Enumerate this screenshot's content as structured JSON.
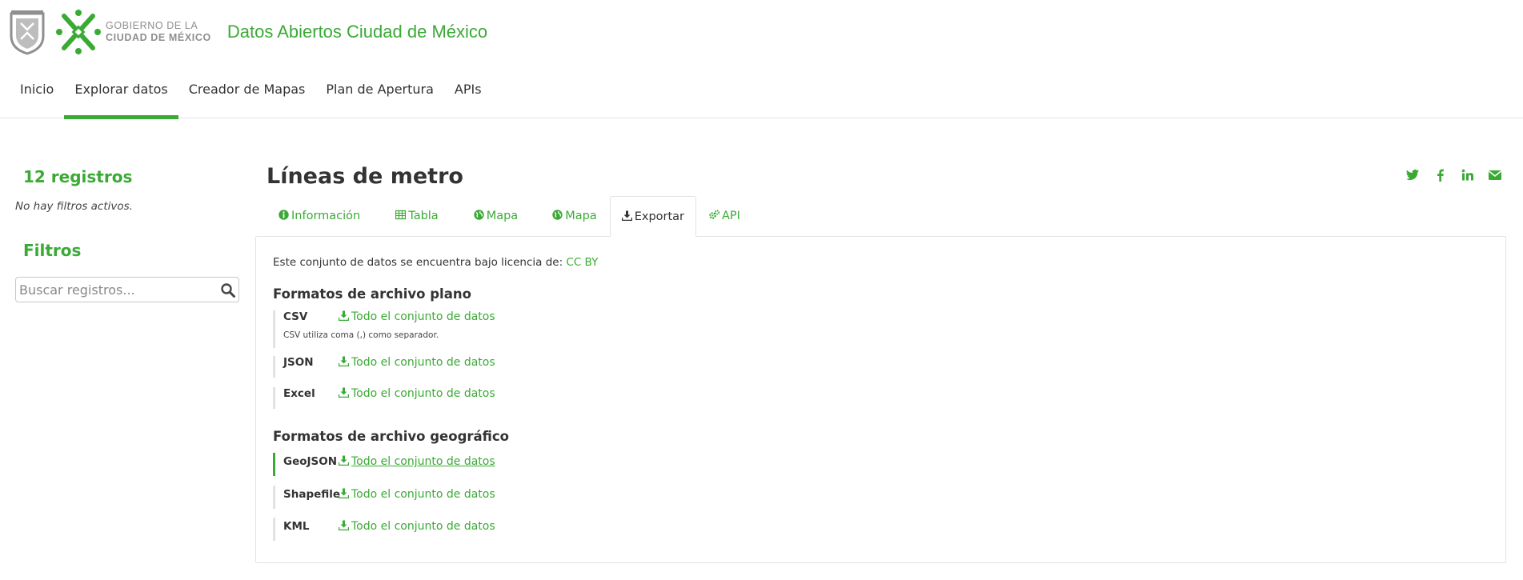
{
  "header": {
    "gov_line1": "GOBIERNO DE LA",
    "gov_line2": "CIUDAD DE MÉXICO",
    "site_title": "Datos Abiertos Ciudad de México",
    "brand_color": "#3aaa35"
  },
  "nav": {
    "items": [
      {
        "label": "Inicio"
      },
      {
        "label": "Explorar datos",
        "active": true
      },
      {
        "label": "Creador de Mapas"
      },
      {
        "label": "Plan de Apertura"
      },
      {
        "label": "APIs"
      }
    ]
  },
  "sidebar": {
    "records": "12 registros",
    "no_filters": "No hay filtros activos.",
    "filters_title": "Filtros",
    "search_placeholder": "Buscar registros..."
  },
  "dataset": {
    "title": "Líneas de metro",
    "share_icons": [
      "twitter-icon",
      "facebook-icon",
      "linkedin-icon",
      "email-icon"
    ]
  },
  "tabs": [
    {
      "label": "Información",
      "icon": "info-icon"
    },
    {
      "label": "Tabla",
      "icon": "table-icon"
    },
    {
      "label": "Mapa",
      "icon": "globe-icon"
    },
    {
      "label": "Mapa",
      "icon": "globe-icon"
    },
    {
      "label": "Exportar",
      "icon": "download-icon",
      "active": true
    },
    {
      "label": "API",
      "icon": "gears-icon"
    }
  ],
  "export": {
    "license_text": "Este conjunto de datos se encuentra bajo licencia de: ",
    "license_link": "CC BY",
    "flat_title": "Formatos de archivo plano",
    "geo_title": "Formatos de archivo geográfico",
    "link_label": "Todo el conjunto de datos",
    "flat_formats": [
      {
        "name": "CSV",
        "note": "CSV utiliza coma (,) como separador."
      },
      {
        "name": "JSON"
      },
      {
        "name": "Excel"
      }
    ],
    "geo_formats": [
      {
        "name": "GeoJSON",
        "hovered": true
      },
      {
        "name": "Shapefile"
      },
      {
        "name": "KML"
      }
    ]
  }
}
